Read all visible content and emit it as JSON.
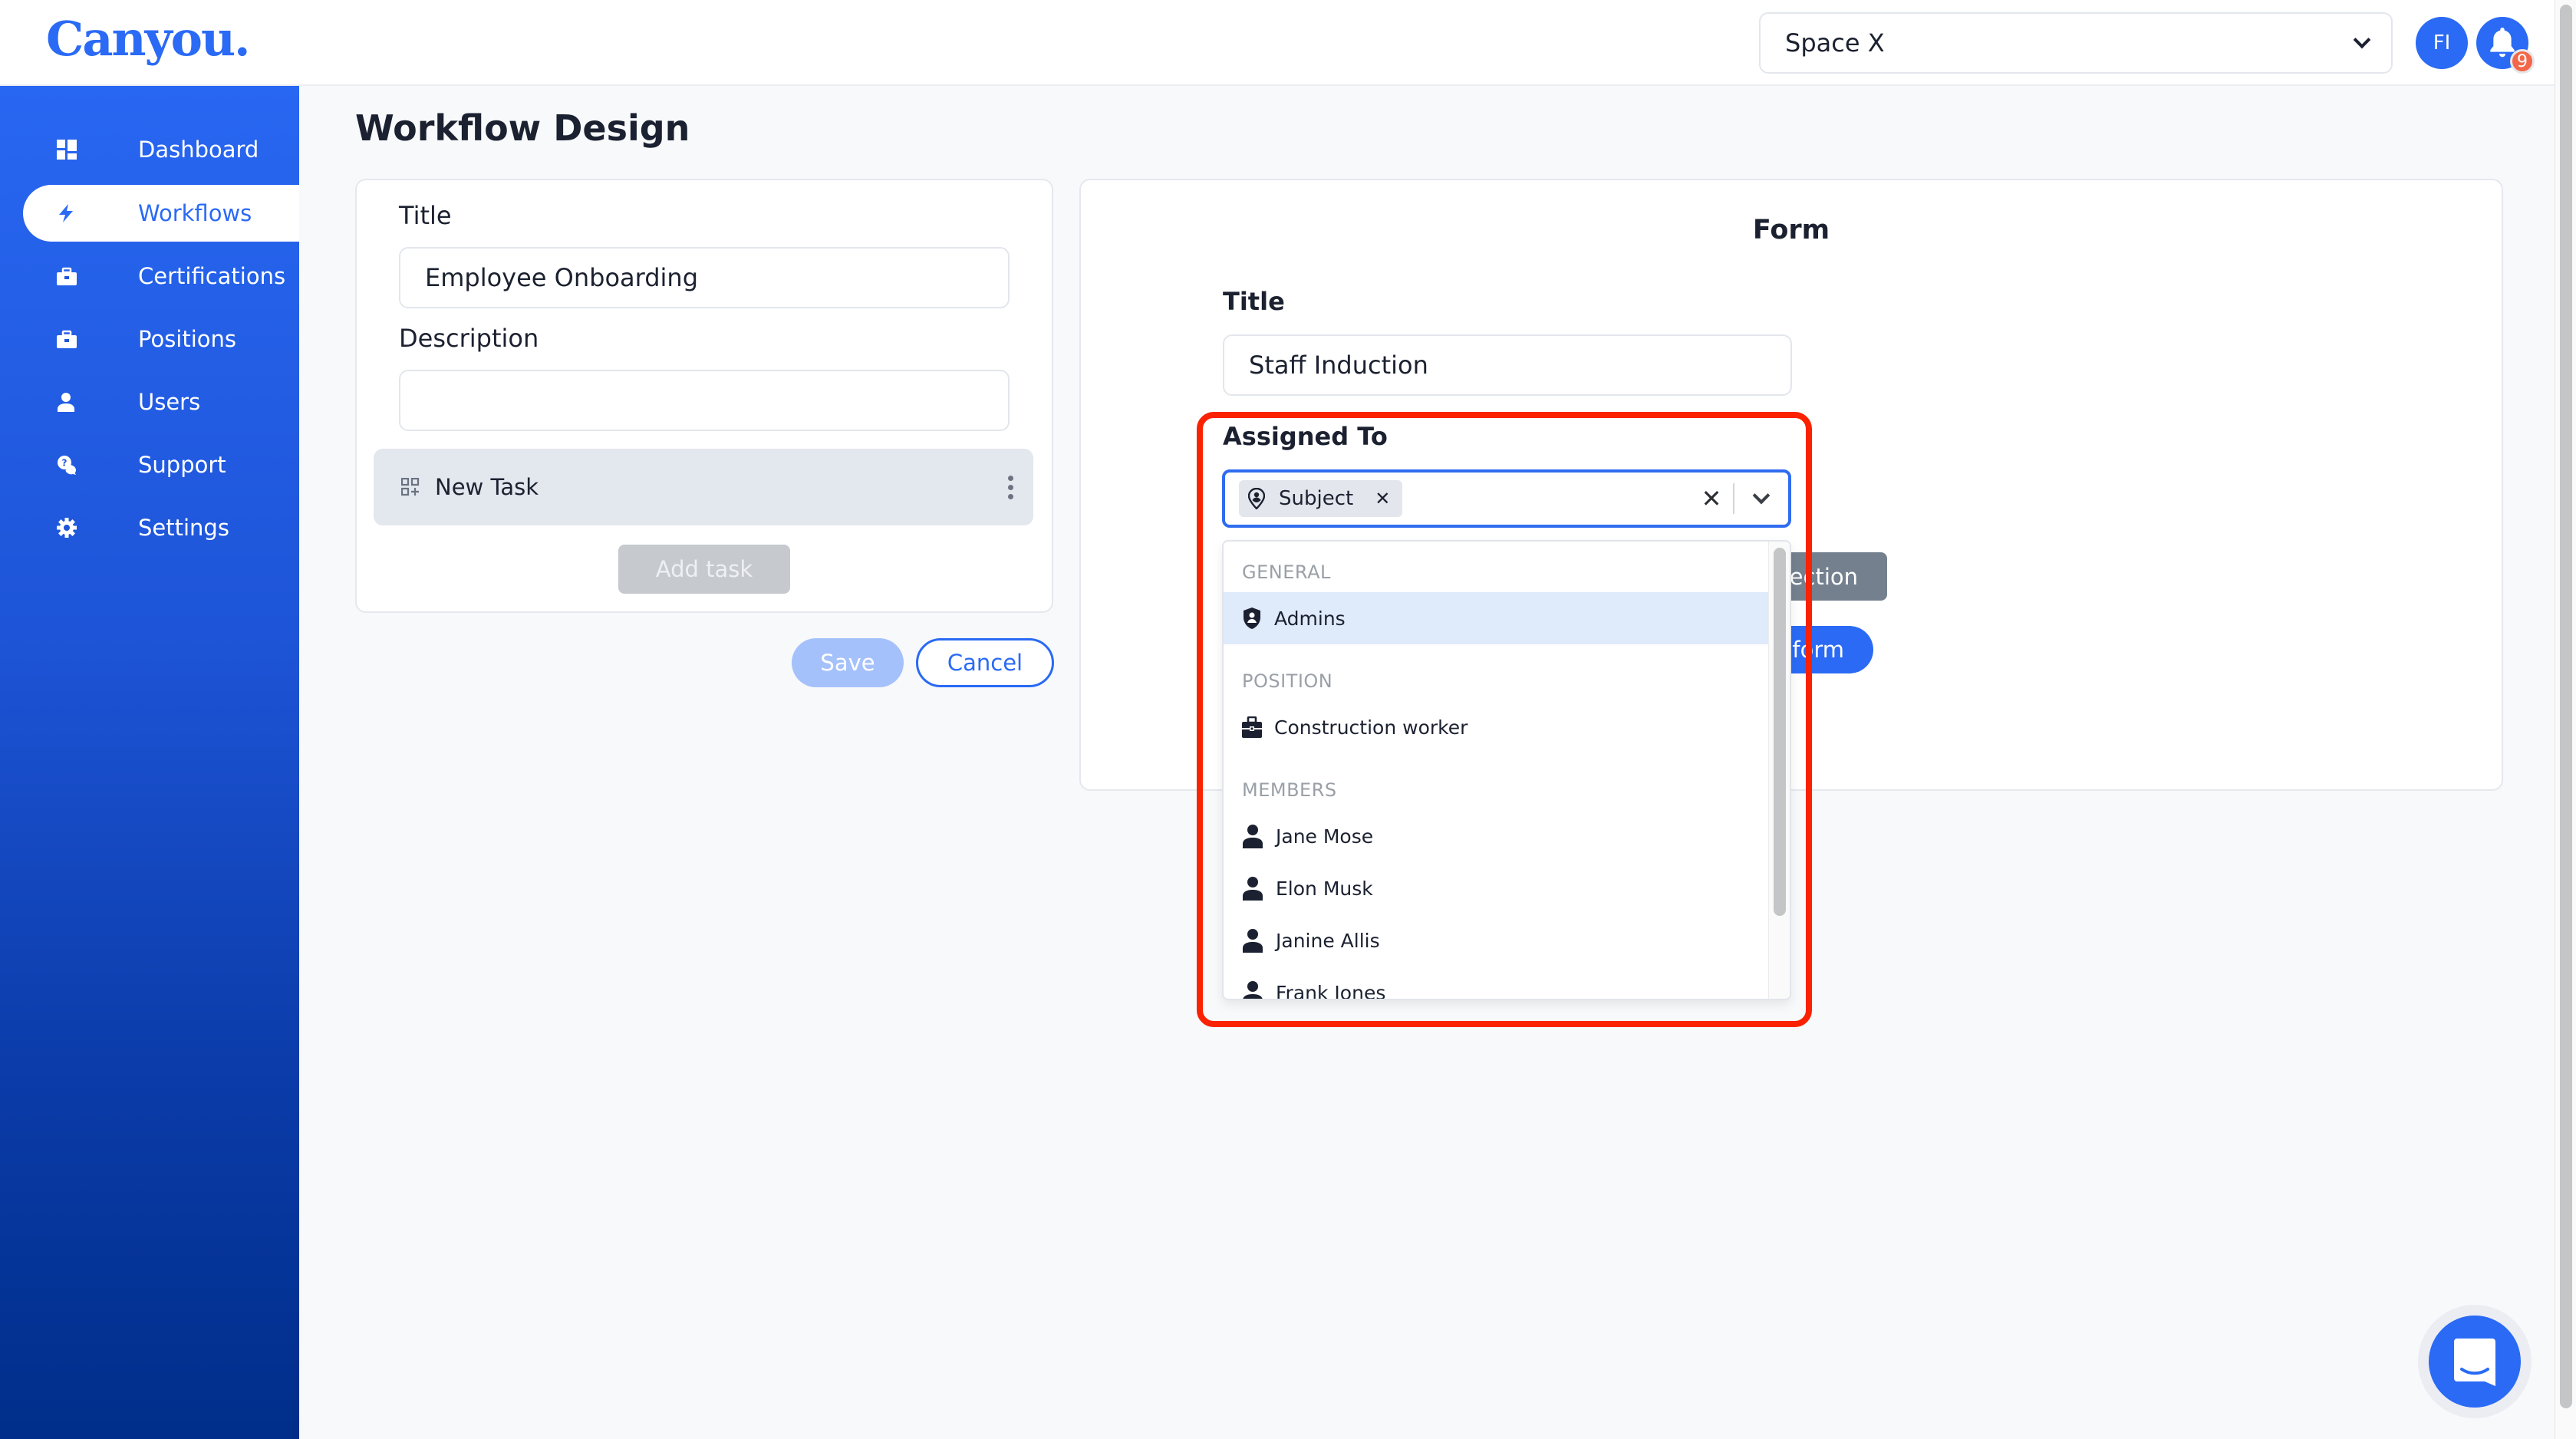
{
  "app": {
    "logo": "Canyou.",
    "brand_color": "#2a6af5"
  },
  "header": {
    "space_select": {
      "value": "Space X",
      "icon": "chevron-down-icon"
    },
    "avatar_initials": "FI",
    "notifications": {
      "icon": "bell-icon",
      "count": "9"
    }
  },
  "sidebar": {
    "active": "Workflows",
    "items": [
      {
        "label": "Dashboard",
        "icon": "dashboard-icon"
      },
      {
        "label": "Workflows",
        "icon": "bolt-icon"
      },
      {
        "label": "Certifications",
        "icon": "briefcase-icon"
      },
      {
        "label": "Positions",
        "icon": "briefcase-icon"
      },
      {
        "label": "Users",
        "icon": "user-icon"
      },
      {
        "label": "Support",
        "icon": "support-chat-icon"
      },
      {
        "label": "Settings",
        "icon": "gear-icon"
      }
    ]
  },
  "page": {
    "title": "Workflow Design"
  },
  "workflow_card": {
    "title_label": "Title",
    "title_value": "Employee Onboarding",
    "description_label": "Description",
    "description_value": "",
    "tasks": [
      {
        "label": "New Task",
        "icon": "task-add-icon",
        "menu_icon": "kebab-menu-icon"
      }
    ],
    "add_task_label": "Add task"
  },
  "actions": {
    "save_label": "Save",
    "cancel_label": "Cancel"
  },
  "form_card": {
    "heading": "Form",
    "title_label": "Title",
    "title_value": "Staff Induction",
    "assigned_label": "Assigned To",
    "selected_chips": [
      {
        "label": "Subject",
        "icon": "location-user-icon",
        "remove_icon": "close-icon"
      }
    ],
    "clear_icon": "close-icon",
    "toggle_icon": "chevron-down-icon",
    "hidden_button_1_partial": "ection",
    "hidden_button_2_partial": "form"
  },
  "dropdown": {
    "groups": [
      {
        "header": "GENERAL",
        "options": [
          {
            "label": "Admins",
            "icon": "shield-user-icon",
            "highlighted": true
          }
        ]
      },
      {
        "header": "POSITION",
        "options": [
          {
            "label": "Construction worker",
            "icon": "briefcase-icon",
            "highlighted": false
          }
        ]
      },
      {
        "header": "MEMBERS",
        "options": [
          {
            "label": "Jane Mose",
            "icon": "user-icon",
            "highlighted": false
          },
          {
            "label": "Elon Musk",
            "icon": "user-icon",
            "highlighted": false
          },
          {
            "label": "Janine Allis",
            "icon": "user-icon",
            "highlighted": false
          },
          {
            "label": "Frank Jones",
            "icon": "user-icon",
            "highlighted": false
          }
        ]
      }
    ]
  },
  "annotation": {
    "highlight_color": "#fa2200"
  },
  "chat_widget": {
    "icon": "chat-bubble-icon"
  }
}
